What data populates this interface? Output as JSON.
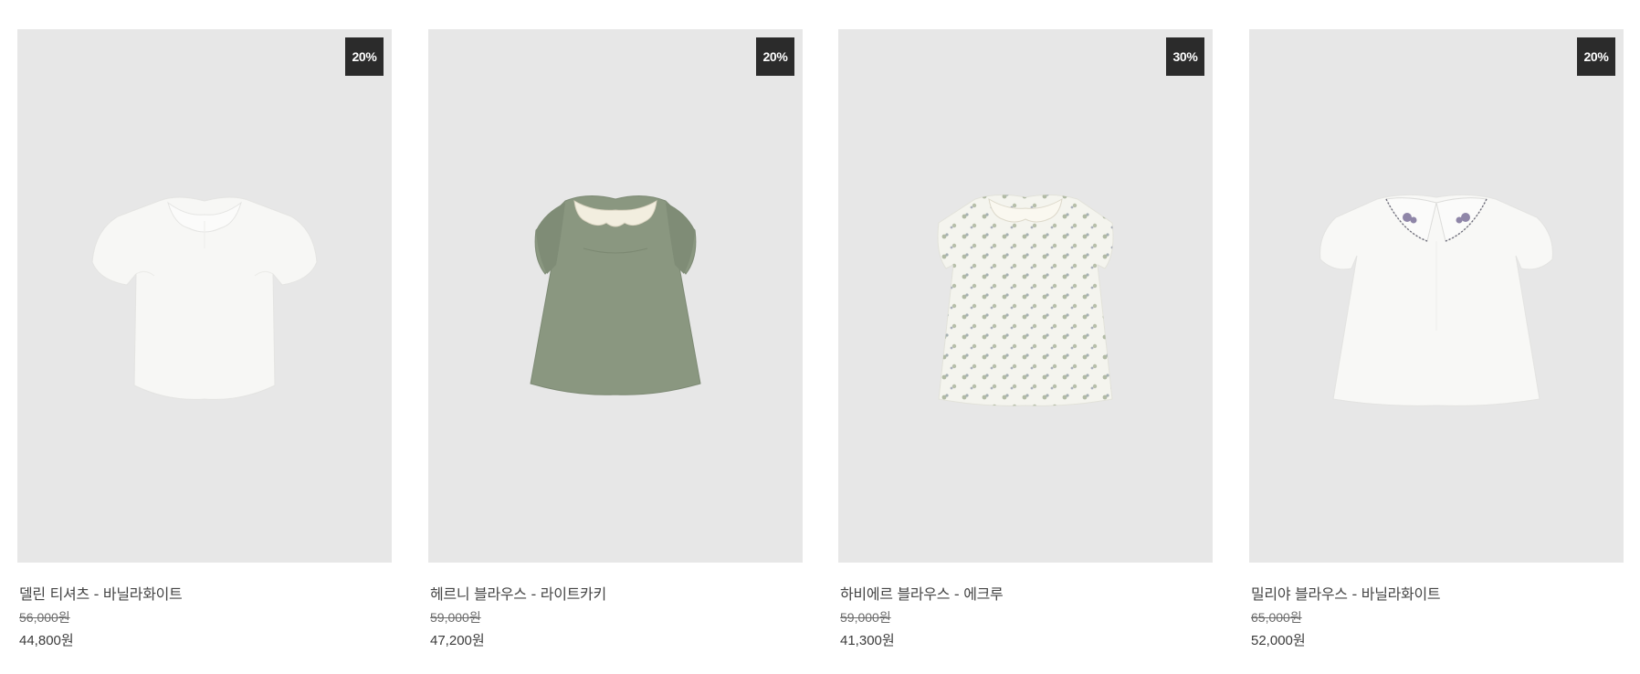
{
  "products": [
    {
      "name": "델린 티셔츠 - 바닐라화이트",
      "discount": "20%",
      "original_price": "56,000원",
      "sale_price": "44,800원",
      "garment_color": "#f7f7f5",
      "icon": "white-puff-sleeve-tshirt"
    },
    {
      "name": "헤르니 블라우스 - 라이트카키",
      "discount": "20%",
      "original_price": "59,000원",
      "sale_price": "47,200원",
      "garment_color": "#8a9780",
      "icon": "khaki-flutter-sleeve-blouse"
    },
    {
      "name": "하비에르 블라우스 - 에크루",
      "discount": "30%",
      "original_price": "59,000원",
      "sale_price": "41,300원",
      "garment_color": "#f4f4ee",
      "icon": "ecru-floral-print-blouse"
    },
    {
      "name": "밀리야 블라우스 - 바닐라화이트",
      "discount": "20%",
      "original_price": "65,000원",
      "sale_price": "52,000원",
      "garment_color": "#f8f8f6",
      "icon": "white-embroidered-collar-blouse"
    }
  ]
}
